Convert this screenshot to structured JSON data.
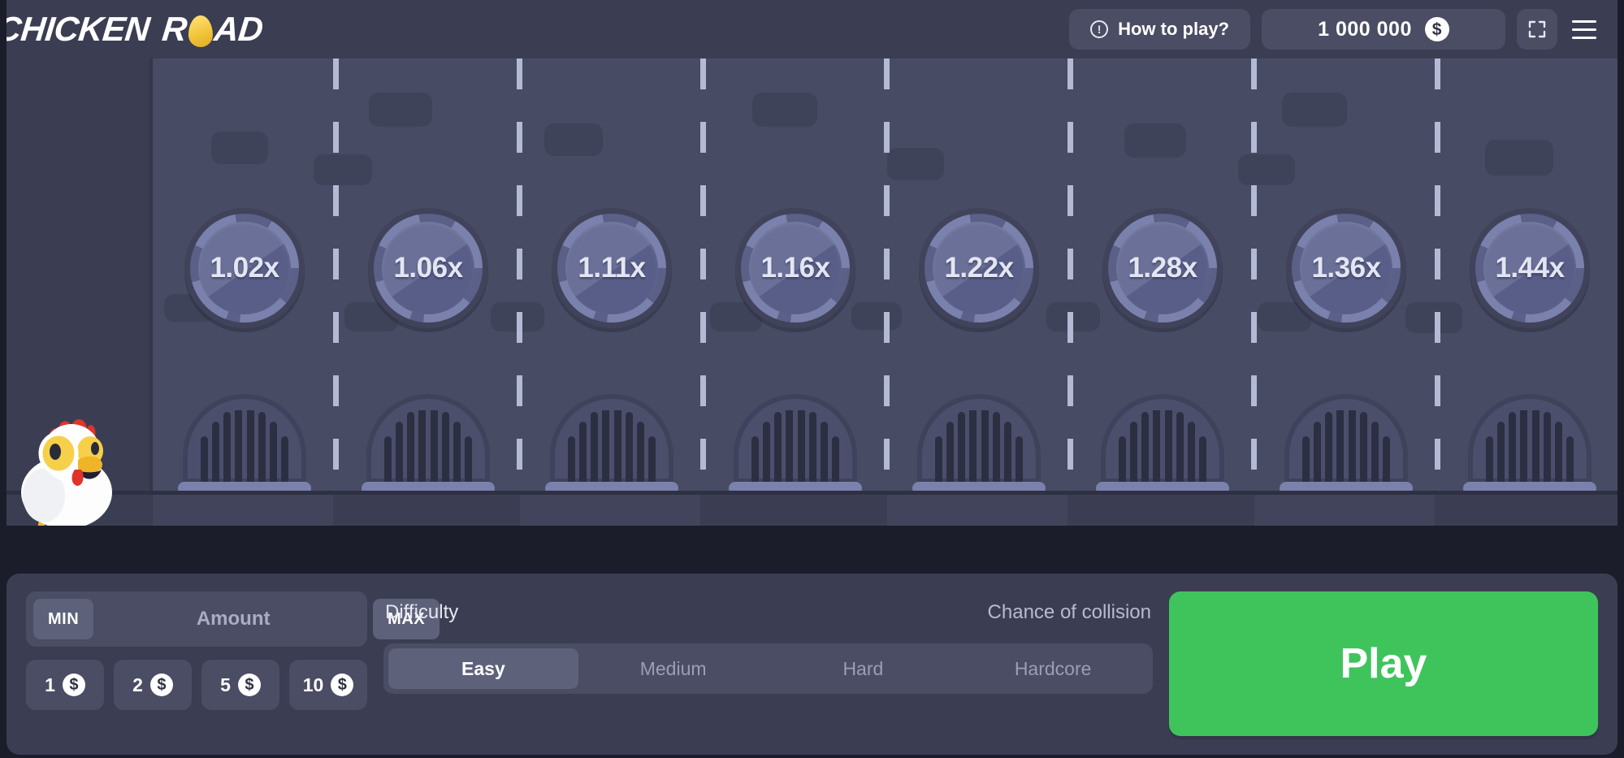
{
  "header": {
    "logo": {
      "word1": "CHICKEN",
      "word2_pre": "R",
      "word2_post": "AD",
      "egg_icon": "egg-icon"
    },
    "how_to_play": {
      "label": "How to play?",
      "icon": "info-circle-icon"
    },
    "balance": {
      "value": "1 000 000",
      "currency_icon": "dollar-coin-icon"
    },
    "fullscreen_icon": "fullscreen-expand-icon",
    "menu_icon": "hamburger-menu-icon"
  },
  "board": {
    "multipliers": [
      "1.02x",
      "1.06x",
      "1.11x",
      "1.16x",
      "1.22x",
      "1.28x",
      "1.36x",
      "1.44x"
    ],
    "character": "chicken-character",
    "lane_count": 8
  },
  "controls": {
    "bet": {
      "min_label": "MIN",
      "max_label": "MAX",
      "amount_placeholder": "Amount",
      "amount_value": "",
      "quick_bets": [
        {
          "value": "1"
        },
        {
          "value": "2"
        },
        {
          "value": "5"
        },
        {
          "value": "10"
        }
      ],
      "currency_icon": "dollar-coin-icon"
    },
    "difficulty": {
      "label": "Difficulty",
      "chance_label": "Chance of collision",
      "options": [
        {
          "label": "Easy",
          "active": true
        },
        {
          "label": "Medium",
          "active": false
        },
        {
          "label": "Hard",
          "active": false
        },
        {
          "label": "Hardcore",
          "active": false
        }
      ]
    },
    "play": {
      "label": "Play"
    }
  },
  "colors": {
    "page_bg": "#1b1d2b",
    "panel_bg": "#3b3e52",
    "road_bg": "#474b63",
    "accent_green": "#3fc45c",
    "token_face": "#5e6490",
    "token_ring": "#7a81ad",
    "egg_yellow": "#f2c53d",
    "text_primary": "#ffffff",
    "text_muted": "#9a9eb6"
  }
}
